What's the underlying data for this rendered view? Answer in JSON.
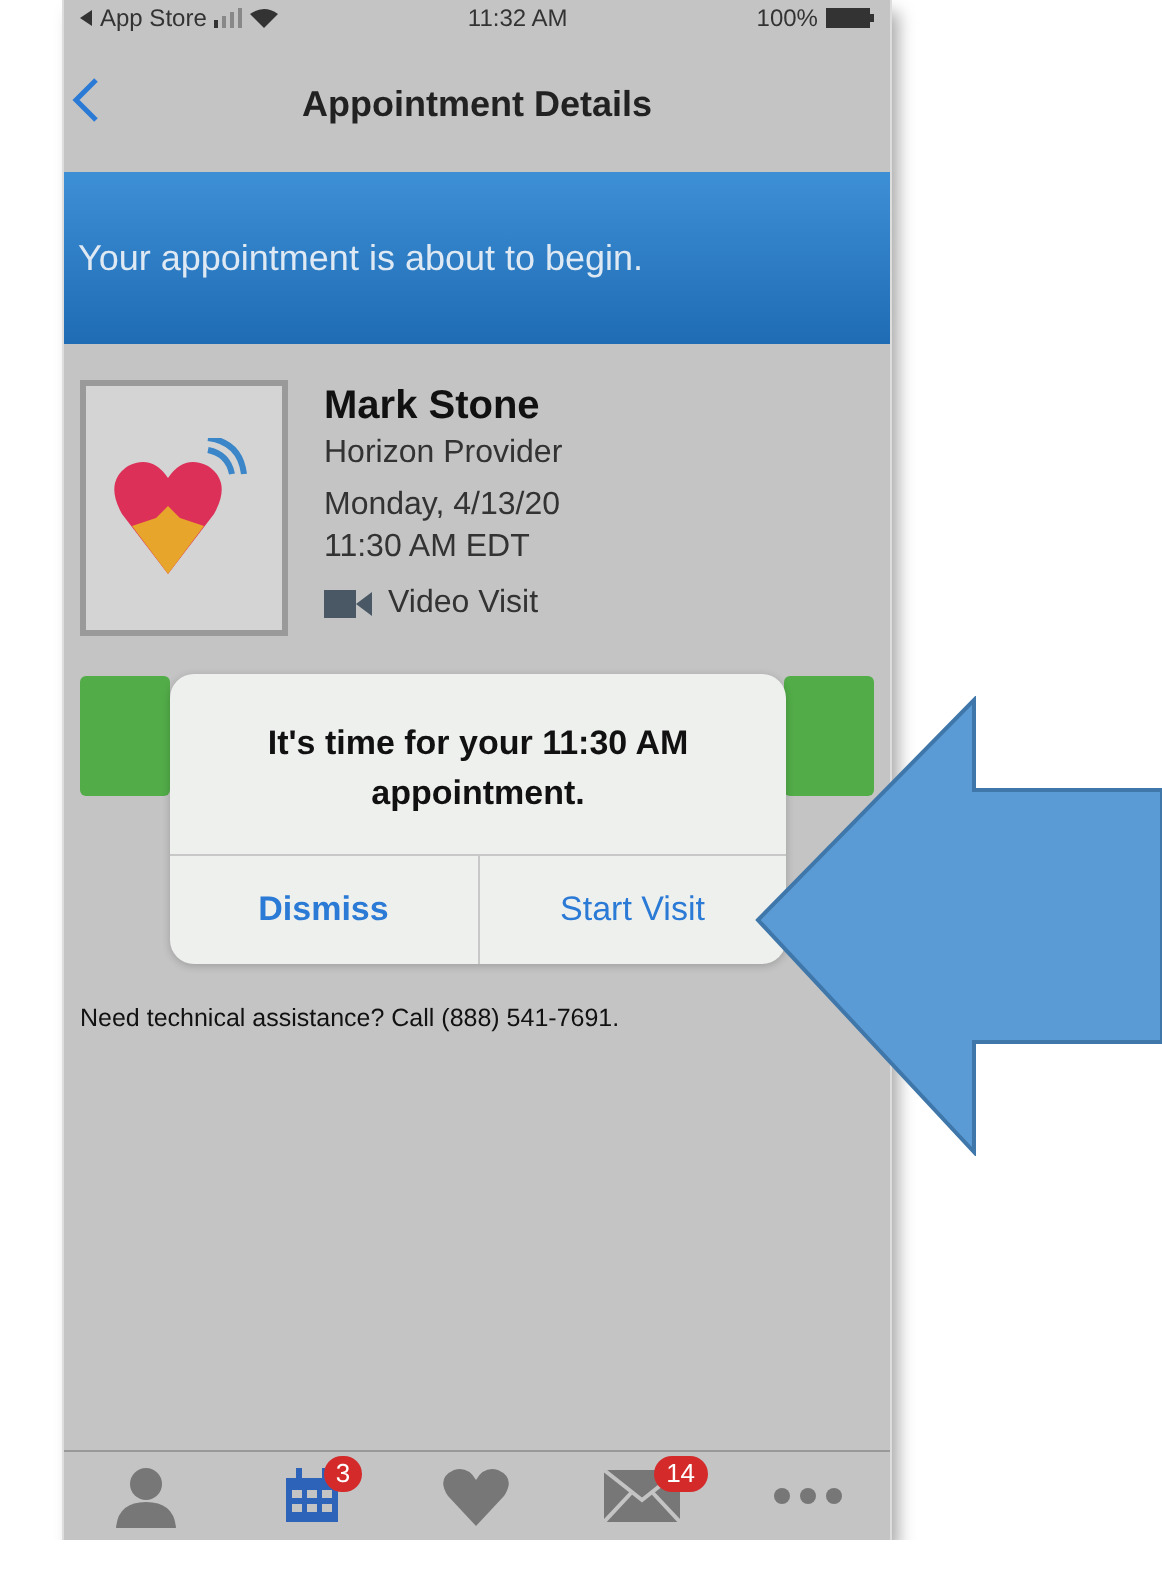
{
  "status_bar": {
    "carrier": "App Store",
    "time": "11:32 AM",
    "battery": "100%"
  },
  "nav": {
    "title": "Appointment Details"
  },
  "banner": "Your appointment is about to begin.",
  "appointment": {
    "name": "Mark Stone",
    "provider": "Horizon Provider",
    "date": "Monday, 4/13/20",
    "time": "11:30 AM EDT",
    "visit_type": "Video Visit"
  },
  "alert": {
    "message": "It's time for your 11:30 AM appointment.",
    "buttons": [
      {
        "label": "Dismiss",
        "kind": "cancel"
      },
      {
        "label": "Start Visit",
        "kind": "default"
      }
    ]
  },
  "help_text": "Need technical assistance? Call (888) 541-7691.",
  "tabs": [
    {
      "kind": "person",
      "selected": false
    },
    {
      "kind": "calendar",
      "selected": true,
      "badge": "3"
    },
    {
      "kind": "heart",
      "selected": false
    },
    {
      "kind": "mail",
      "selected": false,
      "badge": "14"
    },
    {
      "kind": "more",
      "selected": false
    }
  ]
}
